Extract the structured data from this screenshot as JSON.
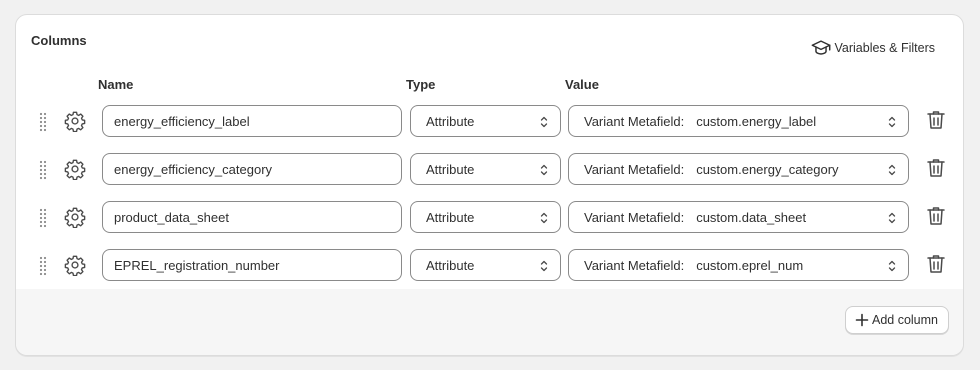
{
  "section": {
    "title": "Columns",
    "variables_filters_label": "Variables & Filters"
  },
  "headers": {
    "name": "Name",
    "type": "Type",
    "value": "Value"
  },
  "rows": [
    {
      "name": "energy_efficiency_label",
      "type": "Attribute",
      "value_source": "Variant Metafield:",
      "value_key": "custom.energy_label"
    },
    {
      "name": "energy_efficiency_category",
      "type": "Attribute",
      "value_source": "Variant Metafield:",
      "value_key": "custom.energy_category"
    },
    {
      "name": "product_data_sheet",
      "type": "Attribute",
      "value_source": "Variant Metafield:",
      "value_key": "custom.data_sheet"
    },
    {
      "name": "EPREL_registration_number",
      "type": "Attribute",
      "value_source": "Variant Metafield:",
      "value_key": "custom.eprel_num"
    }
  ],
  "footer": {
    "add_column_label": "Add column"
  },
  "icons": {
    "drag": "drag-handle-icon",
    "settings": "gear-icon",
    "delete": "trash-icon",
    "select": "chevron-up-down-icon",
    "education": "graduation-cap-icon",
    "add": "plus-icon"
  },
  "colors": {
    "page_bg": "#f1f1f1",
    "card_bg": "#ffffff",
    "footer_bg": "#f6f6f6",
    "field_border": "#8a8a8a",
    "text": "#303030"
  }
}
